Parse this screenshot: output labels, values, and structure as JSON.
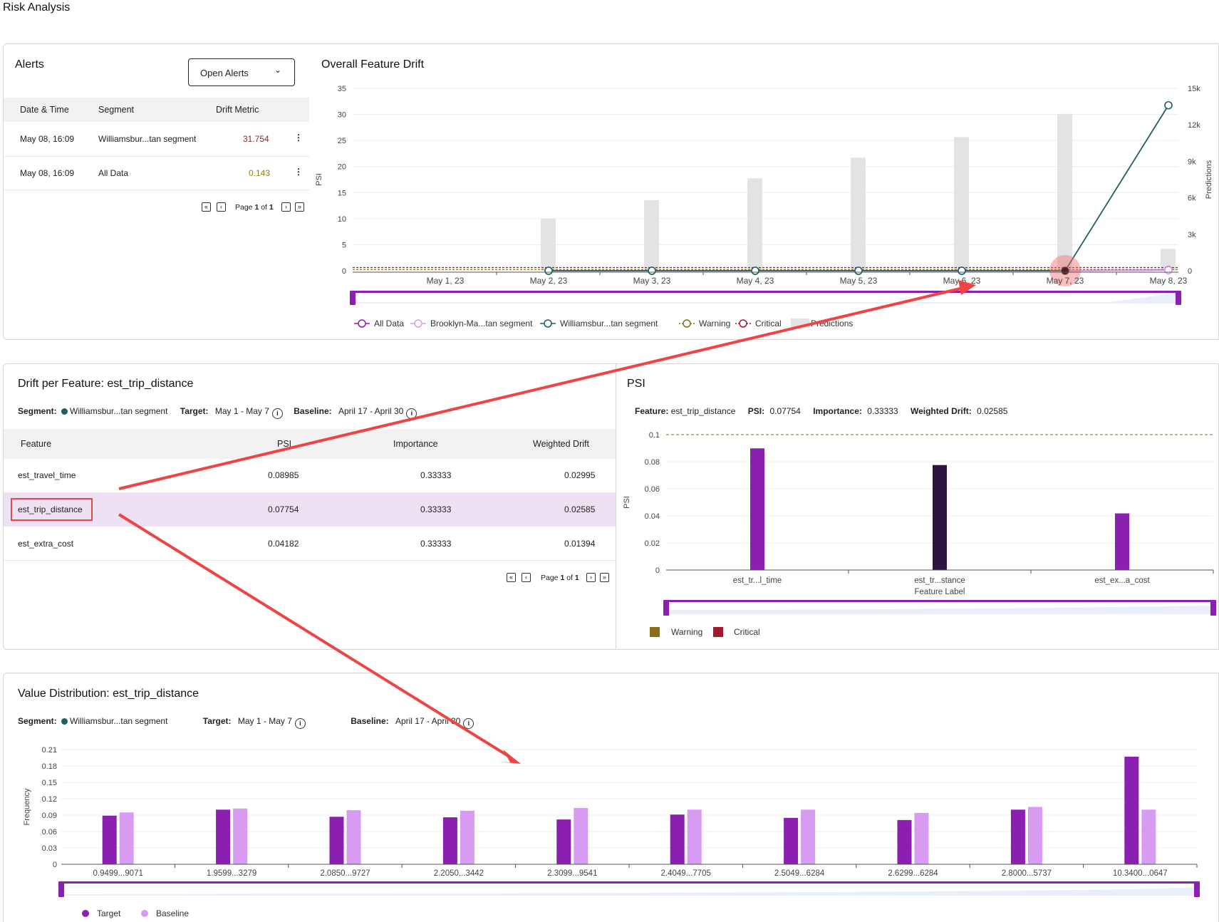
{
  "page": {
    "title": "Risk Analysis"
  },
  "alerts": {
    "title": "Alerts",
    "dropdown": "Open Alerts",
    "columns": [
      "Date & Time",
      "Segment",
      "Drift Metric"
    ],
    "rows": [
      {
        "datetime": "May 08, 16:09",
        "segment": "Williamsbur...tan segment",
        "metric": "31.754",
        "metric_color": "#8b2d2d"
      },
      {
        "datetime": "May 08, 16:09",
        "segment": "All Data",
        "metric": "0.143",
        "metric_color": "#9a7a1a"
      }
    ],
    "pager": {
      "prefix": "Page",
      "page": "1",
      "of": "of",
      "total": "1"
    }
  },
  "overall": {
    "title": "Overall Feature Drift",
    "legend": [
      "All Data",
      "Brooklyn-Ma...tan segment",
      "Williamsbur...tan segment",
      "Warning",
      "Critical",
      "Predictions"
    ]
  },
  "drift_per_feature": {
    "title": "Drift per Feature: est_trip_distance",
    "segment_label": "Segment:",
    "segment_value": "Williamsbur...tan segment",
    "target_label": "Target:",
    "target_value": "May 1 - May 7",
    "baseline_label": "Baseline:",
    "baseline_value": "April 17 - April 30",
    "columns": [
      "Feature",
      "PSI",
      "Importance",
      "Weighted Drift"
    ],
    "rows": [
      {
        "feature": "est_travel_time",
        "psi": "0.08985",
        "importance": "0.33333",
        "weighted": "0.02995"
      },
      {
        "feature": "est_trip_distance",
        "psi": "0.07754",
        "importance": "0.33333",
        "weighted": "0.02585"
      },
      {
        "feature": "est_extra_cost",
        "psi": "0.04182",
        "importance": "0.33333",
        "weighted": "0.01394"
      }
    ],
    "pager": {
      "prefix": "Page",
      "page": "1",
      "of": "of",
      "total": "1"
    }
  },
  "psi_panel": {
    "title": "PSI",
    "feature_label": "Feature:",
    "feature_value": "est_trip_distance",
    "psi_label": "PSI:",
    "psi_value": "0.07754",
    "importance_label": "Importance:",
    "importance_value": "0.33333",
    "weighted_label": "Weighted Drift:",
    "weighted_value": "0.02585",
    "legend": [
      "Warning",
      "Critical"
    ]
  },
  "value_distribution": {
    "title": "Value Distribution: est_trip_distance",
    "segment_label": "Segment:",
    "segment_value": "Williamsbur...tan segment",
    "target_label": "Target:",
    "target_value": "May 1 - May 7",
    "baseline_label": "Baseline:",
    "baseline_value": "April 17 - April 30",
    "legend": [
      "Target",
      "Baseline"
    ]
  },
  "colors": {
    "accent": "#8a1fb0",
    "target": "#8a1fb0",
    "baseline": "#d79cf2",
    "selected": "#2e1541",
    "williamsburg": "#1f5f66",
    "warning": "#8c6d12",
    "critical": "#a3192c",
    "annotation": "#ef4444"
  },
  "chart_data": [
    {
      "type": "line",
      "title": "Overall Feature Drift",
      "x": [
        "May 1, 23",
        "May 2, 23",
        "May 3, 23",
        "May 4, 23",
        "May 5, 23",
        "May 6, 23",
        "May 7, 23",
        "May 8, 23"
      ],
      "ylabel": "PSI",
      "ylim": [
        0,
        35
      ],
      "yticks": [
        0,
        5,
        10,
        15,
        20,
        25,
        30,
        35
      ],
      "y2label": "Predictions",
      "y2lim": [
        0,
        15000
      ],
      "y2ticks": [
        "0",
        "3k",
        "6k",
        "9k",
        "12k",
        "15k"
      ],
      "series": [
        {
          "name": "All Data",
          "values": [
            null,
            0,
            0,
            0,
            0,
            0,
            0,
            0.143
          ]
        },
        {
          "name": "Brooklyn-Ma...tan segment",
          "values": [
            null,
            0,
            0,
            0,
            0,
            0,
            0,
            0.1
          ]
        },
        {
          "name": "Williamsbur...tan segment",
          "values": [
            null,
            0,
            0,
            0,
            0,
            0,
            0,
            31.754
          ]
        }
      ],
      "thresholds": {
        "Warning": 0.1,
        "Critical": 0.2
      },
      "bars": {
        "name": "Predictions",
        "values": [
          0,
          4300,
          5800,
          7600,
          9300,
          11000,
          12900,
          1800
        ]
      }
    },
    {
      "type": "bar",
      "title": "PSI",
      "categories": [
        "est_tr...l_time",
        "est_tr...stance",
        "est_ex...a_cost"
      ],
      "values": [
        0.08985,
        0.07754,
        0.04182
      ],
      "selected": "est_tr...stance",
      "xlabel": "Feature Label",
      "ylabel": "PSI",
      "ylim": [
        0,
        0.1
      ],
      "yticks": [
        "0",
        "0.02",
        "0.04",
        "0.06",
        "0.08",
        "0.1"
      ],
      "threshold_line": 0.1
    },
    {
      "type": "bar",
      "title": "Value Distribution: est_trip_distance",
      "categories": [
        "0.9499...9071",
        "1.9599...3279",
        "2.0850...9727",
        "2.2050...3442",
        "2.3099...9541",
        "2.4049...7705",
        "2.5049...6284",
        "2.6299...6284",
        "2.8000...5737",
        "10.3400...0647"
      ],
      "ylabel": "Frequency",
      "ylim": [
        0,
        0.21
      ],
      "yticks": [
        "0",
        "0.03",
        "0.06",
        "0.09",
        "0.12",
        "0.15",
        "0.18",
        "0.21"
      ],
      "series": [
        {
          "name": "Target",
          "values": [
            0.089,
            0.1,
            0.087,
            0.086,
            0.082,
            0.091,
            0.085,
            0.081,
            0.1,
            0.197
          ]
        },
        {
          "name": "Baseline",
          "values": [
            0.095,
            0.102,
            0.099,
            0.098,
            0.103,
            0.1,
            0.1,
            0.094,
            0.105,
            0.1
          ]
        }
      ]
    }
  ]
}
